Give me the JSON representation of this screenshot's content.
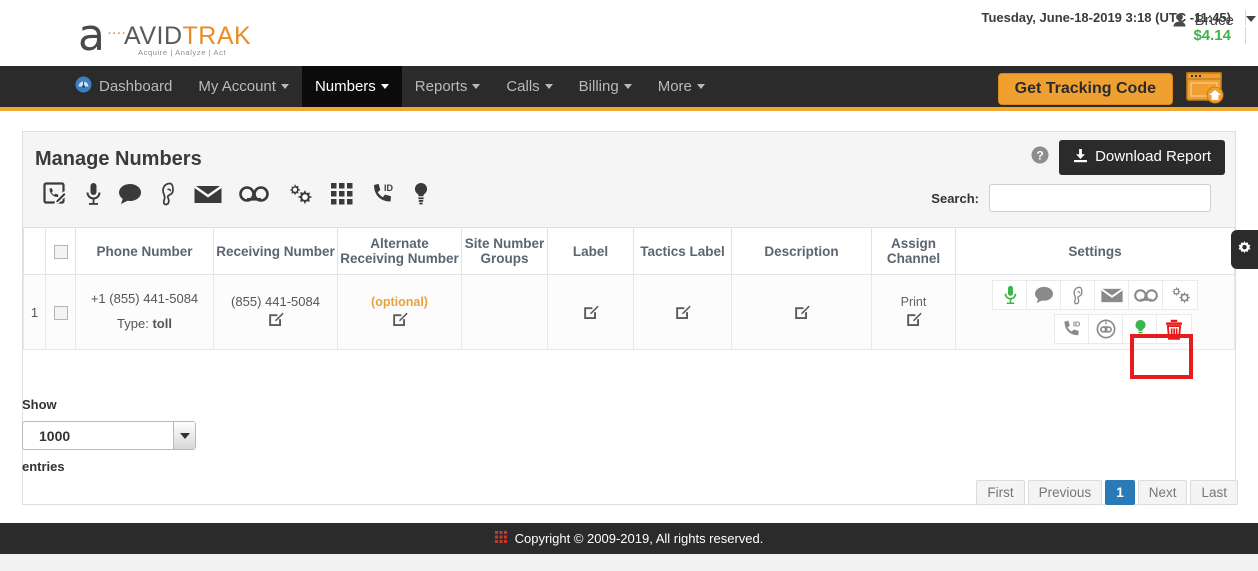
{
  "header": {
    "logo": {
      "letter": "a",
      "dots": "····",
      "word_1": "AVID",
      "word_2": "TRAK",
      "tagline": "Acquire  |  Analyze  |  Act"
    },
    "datetime": "Tuesday, June-18-2019 3:18 (UTC -11:45)",
    "balance": "$4.14",
    "user_name": "Bruce",
    "user_icon": "person-icon",
    "caret_icon": "chevron-down-icon"
  },
  "nav": {
    "items": [
      {
        "label": "Dashboard",
        "icon": "dashboard-gauge-icon",
        "has_caret": false,
        "active": false
      },
      {
        "label": "My Account",
        "icon": "",
        "has_caret": true,
        "active": false
      },
      {
        "label": "Numbers",
        "icon": "",
        "has_caret": true,
        "active": true
      },
      {
        "label": "Reports",
        "icon": "",
        "has_caret": true,
        "active": false
      },
      {
        "label": "Calls",
        "icon": "",
        "has_caret": true,
        "active": false
      },
      {
        "label": "Billing",
        "icon": "",
        "has_caret": true,
        "active": false
      },
      {
        "label": "More",
        "icon": "",
        "has_caret": true,
        "active": false
      }
    ],
    "tracking_button": "Get Tracking Code",
    "window_icon": "browser-window-home-icon",
    "accent_color": "#f0a830"
  },
  "panel": {
    "title": "Manage Numbers",
    "toolbar_icons": [
      "phone-edit-icon",
      "microphone-icon",
      "chat-bubble-icon",
      "whisper-ear-icon",
      "envelope-icon",
      "voicemail-icon",
      "gears-icon",
      "keypad-grid-icon",
      "caller-id-phone-icon",
      "lightbulb-icon"
    ],
    "help_icon": "question-circle-icon",
    "download_button": "Download Report",
    "download_icon": "download-icon",
    "search_label": "Search:",
    "search_value": "",
    "search_placeholder": "",
    "gear_tab_icon": "gear-icon"
  },
  "table": {
    "columns": [
      "",
      "",
      "Phone Number",
      "Receiving Number",
      "Alternate Receiving Number",
      "Site Number Groups",
      "Label",
      "Tactics Label",
      "Description",
      "Assign Channel",
      "Settings"
    ],
    "rows": [
      {
        "index": "1",
        "checked": false,
        "phone_number": "+1 (855) 441-5084",
        "type_label": "Type:",
        "type_value": "toll",
        "receiving_number": "(855) 441-5084",
        "alternate_receiving_number": "(optional)",
        "site_number_groups": "",
        "label": "",
        "tactics_label": "",
        "description": "",
        "assign_channel": "Print",
        "edit_icon": "edit-square-icon",
        "settings_icons_row1": [
          {
            "name": "microphone-icon",
            "color": "#3cb44a"
          },
          {
            "name": "chat-bubble-icon",
            "color": "#8a8a8a"
          },
          {
            "name": "whisper-ear-icon",
            "color": "#8a8a8a"
          },
          {
            "name": "envelope-icon",
            "color": "#8a8a8a"
          },
          {
            "name": "voicemail-icon",
            "color": "#8a8a8a"
          },
          {
            "name": "gears-icon",
            "color": "#8a8a8a"
          }
        ],
        "settings_icons_row2": [
          {
            "name": "caller-id-phone-icon",
            "color": "#8a8a8a"
          },
          {
            "name": "robot-face-icon",
            "color": "#8a8a8a"
          },
          {
            "name": "lightbulb-icon",
            "color": "#3cb44a"
          },
          {
            "name": "trash-delete-icon",
            "color": "#e71b1b"
          }
        ]
      }
    ]
  },
  "controls": {
    "show_label": "Show",
    "entries_label": "entries",
    "entries_value": "1000",
    "select_arrow_icon": "chevron-down-icon",
    "pagination": [
      {
        "label": "First",
        "active": false
      },
      {
        "label": "Previous",
        "active": false
      },
      {
        "label": "1",
        "active": true
      },
      {
        "label": "Next",
        "active": false
      },
      {
        "label": "Last",
        "active": false
      }
    ],
    "active_page_color": "#2b7ab8"
  },
  "footer": {
    "icon": "grid-icon",
    "text": "Copyright © 2009-2019, All rights reserved."
  },
  "annotation": {
    "highlight_color": "#e71b1b",
    "target": "trash-delete-icon"
  }
}
